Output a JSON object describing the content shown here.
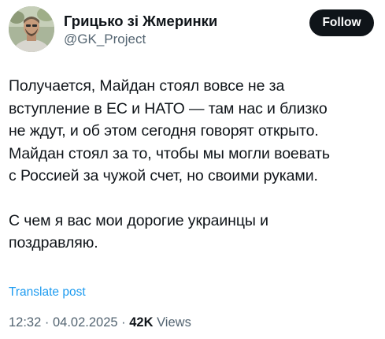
{
  "author": {
    "display_name": "Грицько зі Жмеринки",
    "handle": "@GK_Project",
    "avatar_icon": "profile-photo"
  },
  "follow_button": {
    "label": "Follow"
  },
  "tweet": {
    "paragraph_1": "Получается, Майдан стоял вовсе не за\nвступление в ЕС и НАТО — там нас и близко\nне ждут, и об этом сегодня говорят открыто.\nМайдан стоял за то, чтобы мы могли воевать\nс Россией за чужой счет, но своими руками.",
    "paragraph_2": "С чем я вас мои дорогие украинцы и\nпоздравляю."
  },
  "translate_link": {
    "label": "Translate post"
  },
  "meta": {
    "time": "12:32",
    "separator_1": " · ",
    "date": "04.02.2025",
    "separator_2": " · ",
    "views_count": "42K",
    "views_label": " Views"
  },
  "colors": {
    "text": "#0f1419",
    "secondary": "#536471",
    "link": "#1d9bf0",
    "follow_bg": "#0f1419"
  }
}
